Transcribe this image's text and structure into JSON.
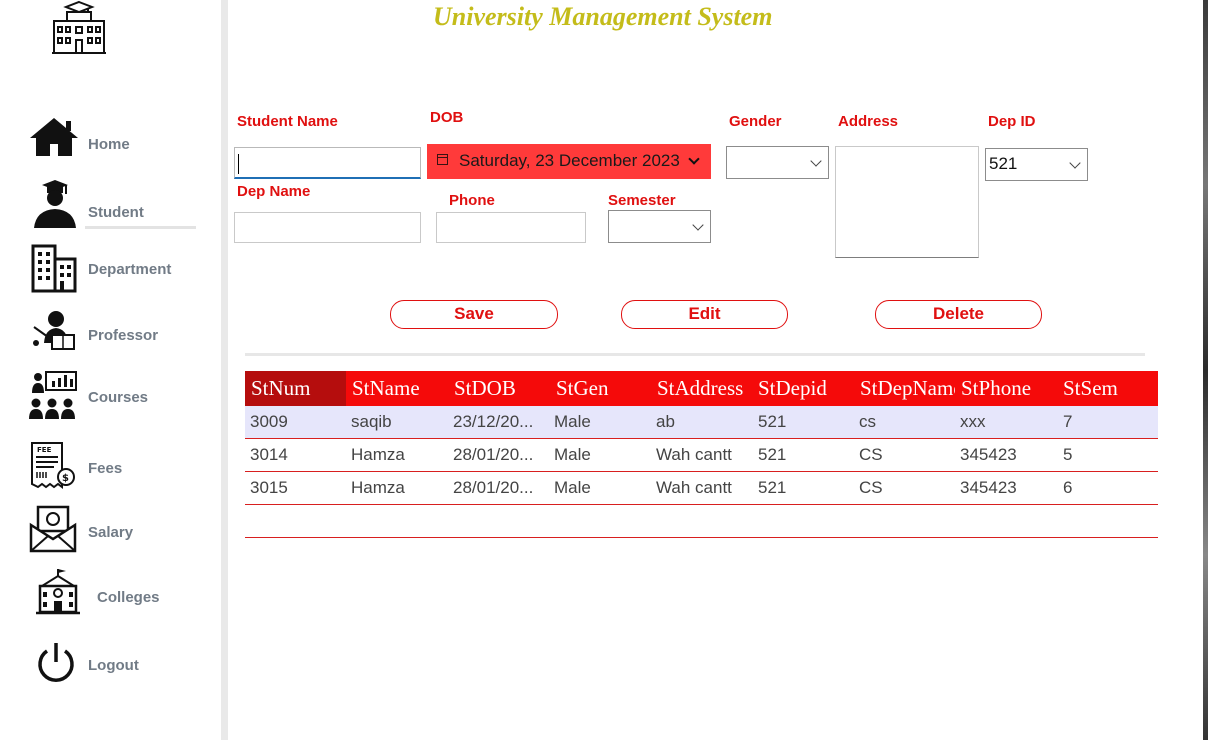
{
  "app": {
    "title": "University Management System"
  },
  "sidebar": {
    "items": [
      {
        "label": "Home",
        "icon": "home-icon"
      },
      {
        "label": "Student",
        "icon": "student-icon"
      },
      {
        "label": "Department",
        "icon": "department-building-icon"
      },
      {
        "label": "Professor",
        "icon": "professor-icon"
      },
      {
        "label": "Courses",
        "icon": "courses-icon"
      },
      {
        "label": "Fees",
        "icon": "fees-receipt-icon"
      },
      {
        "label": "Salary",
        "icon": "salary-envelope-icon"
      },
      {
        "label": "Colleges",
        "icon": "college-building-icon"
      },
      {
        "label": "Logout",
        "icon": "power-icon"
      }
    ],
    "active": "Student"
  },
  "form": {
    "labels": {
      "student_name": "Student Name",
      "dob": "DOB",
      "gender": "Gender",
      "address": "Address",
      "dep_id": "Dep ID",
      "dep_name": "Dep Name",
      "phone": "Phone",
      "semester": "Semester"
    },
    "values": {
      "student_name": "",
      "dob": "Saturday, 23 December 2023",
      "gender": "",
      "address": "",
      "dep_id": "521",
      "dep_name": "",
      "phone": "",
      "semester": ""
    }
  },
  "buttons": {
    "save": "Save",
    "edit": "Edit",
    "delete": "Delete"
  },
  "table": {
    "columns": [
      "StNum",
      "StName",
      "StDOB",
      "StGen",
      "StAddress",
      "StDepid",
      "StDepName",
      "StPhone",
      "StSem"
    ],
    "rows": [
      [
        "3009",
        "saqib",
        "23/12/20...",
        "Male",
        "ab",
        "521",
        "cs",
        "xxx",
        "7"
      ],
      [
        "3014",
        "Hamza",
        "28/01/20...",
        "Male",
        "Wah cantt",
        "521",
        "CS",
        "345423",
        "5"
      ],
      [
        "3015",
        "Hamza",
        "28/01/20...",
        "Male",
        "Wah cantt",
        "521",
        "CS",
        "345423",
        "6"
      ]
    ],
    "selected_row": 0
  },
  "colors": {
    "accent": "#e01010",
    "title": "#c4bc1a",
    "header_bg": "#f50a0a",
    "selected_row": "#e6e6fb"
  }
}
